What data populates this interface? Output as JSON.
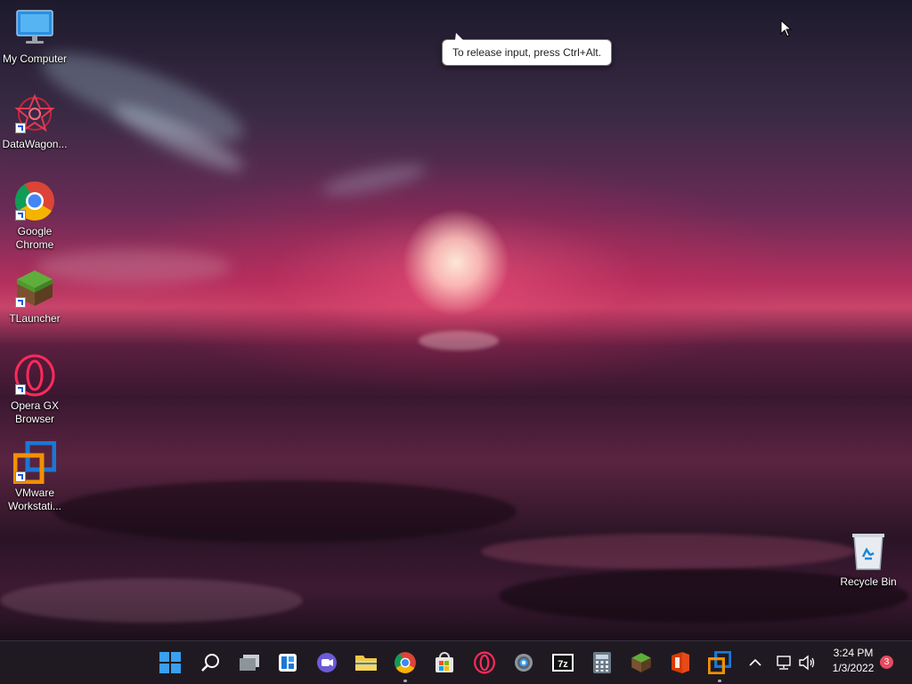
{
  "desktop": {
    "icons": [
      {
        "label": "My Computer"
      },
      {
        "label": "DataWagon..."
      },
      {
        "label": "Google Chrome"
      },
      {
        "label": "TLauncher"
      },
      {
        "label": "Opera GX Browser"
      },
      {
        "label": "VMware Workstati..."
      },
      {
        "label": "Recycle Bin"
      }
    ]
  },
  "tooltip": {
    "text": "To release input, press Ctrl+Alt."
  },
  "tray": {
    "time": "3:24 PM",
    "date": "1/3/2022",
    "notification_count": "3"
  },
  "colors": {
    "taskbar_bg": "#1f1a22",
    "notification_badge": "#e84a5f",
    "accent_blue": "#1a78d6"
  }
}
